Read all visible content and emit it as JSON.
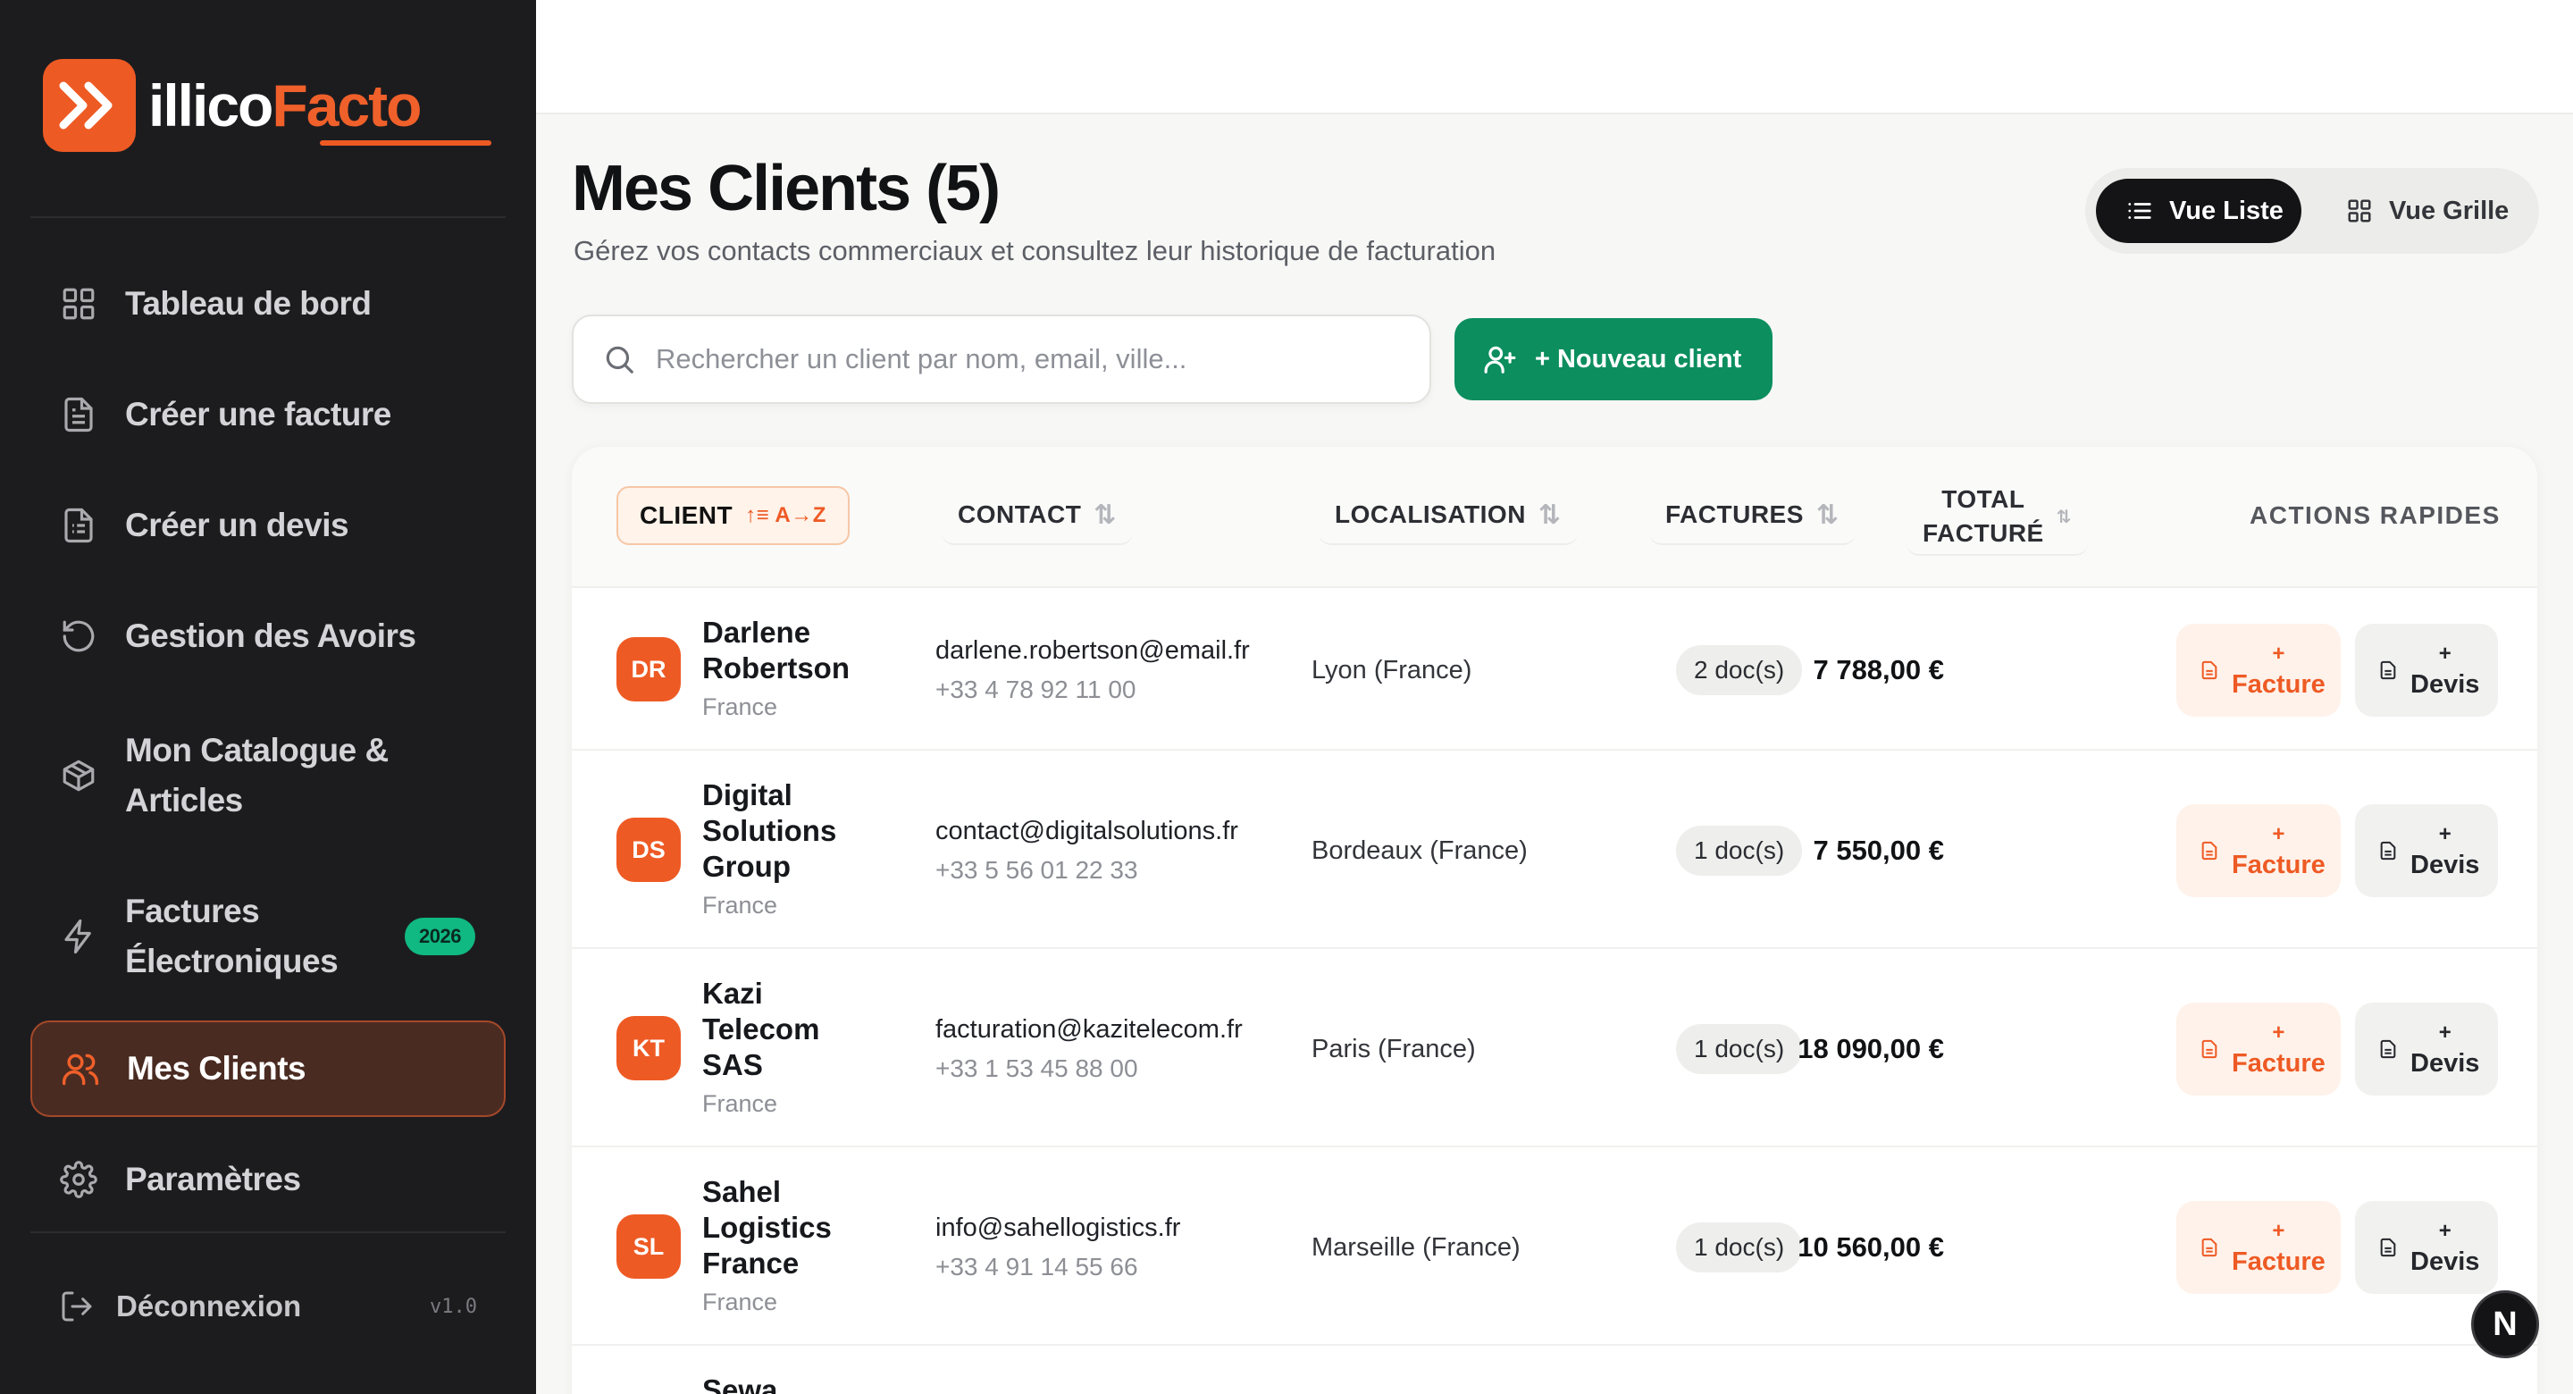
{
  "brand": {
    "name_part1": "illico",
    "name_part2": "Facto",
    "color": "#ee5a24"
  },
  "sidebar": {
    "items": [
      {
        "label": "Tableau de bord",
        "icon": "grid-icon"
      },
      {
        "label": "Créer une facture",
        "icon": "document-icon"
      },
      {
        "label": "Créer un devis",
        "icon": "document-list-icon"
      },
      {
        "label": "Gestion des Avoirs",
        "icon": "rotate-ccw-icon"
      },
      {
        "label_line1": "Mon Catalogue &",
        "label_line2": "Articles",
        "icon": "box-icon"
      },
      {
        "label_line1": "Factures",
        "label_line2": "Électroniques",
        "icon": "zap-icon",
        "badge": "2026"
      },
      {
        "label": "Mes Clients",
        "icon": "users-icon",
        "active": true
      },
      {
        "label": "Paramètres",
        "icon": "gear-icon"
      }
    ],
    "logout_label": "Déconnexion",
    "version": "v1.0"
  },
  "page": {
    "title": "Mes Clients (5)",
    "subtitle": "Gérez vos contacts commerciaux et consultez leur historique de facturation"
  },
  "view_toggle": {
    "list_label": "Vue Liste",
    "grid_label": "Vue Grille",
    "selected": "list"
  },
  "search": {
    "placeholder": "Rechercher un client par nom, email, ville...",
    "value": ""
  },
  "new_client_label": "+ Nouveau client",
  "table": {
    "headers": {
      "client": "CLIENT",
      "client_sort": "A→Z",
      "contact": "CONTACT",
      "location": "LOCALISATION",
      "invoices": "FACTURES",
      "total_line1": "TOTAL",
      "total_line2": "FACTURÉ",
      "actions": "ACTIONS RAPIDES"
    },
    "rows": [
      {
        "initials": "DR",
        "name_lines": [
          "Darlene",
          "Robertson"
        ],
        "country": "France",
        "email": "darlene.robertson@email.fr",
        "phone": "+33 4 78 92 11 00",
        "location": "Lyon (France)",
        "docs": "2 doc(s)",
        "total": "7 788,00 €"
      },
      {
        "initials": "DS",
        "name_lines": [
          "Digital",
          "Solutions",
          "Group"
        ],
        "country": "France",
        "email": "contact@digitalsolutions.fr",
        "phone": "+33 5 56 01 22 33",
        "location": "Bordeaux (France)",
        "docs": "1 doc(s)",
        "total": "7 550,00 €"
      },
      {
        "initials": "KT",
        "name_lines": [
          "Kazi",
          "Telecom",
          "SAS"
        ],
        "country": "France",
        "email": "facturation@kazitelecom.fr",
        "phone": "+33 1 53 45 88 00",
        "location": "Paris (France)",
        "docs": "1 doc(s)",
        "total": "18 090,00 €"
      },
      {
        "initials": "SL",
        "name_lines": [
          "Sahel",
          "Logistics",
          "France"
        ],
        "country": "France",
        "email": "info@sahellogistics.fr",
        "phone": "+33 4 91 14 55 66",
        "location": "Marseille (France)",
        "docs": "1 doc(s)",
        "total": "10 560,00 €"
      },
      {
        "initials": "",
        "name_lines": [
          "Sewa"
        ],
        "country": "",
        "email": "",
        "phone": "",
        "location": "",
        "docs": "",
        "total": ""
      }
    ],
    "actions": {
      "plus": "+",
      "invoice": "Facture",
      "quote": "Devis"
    }
  },
  "assistant_badge": "N"
}
